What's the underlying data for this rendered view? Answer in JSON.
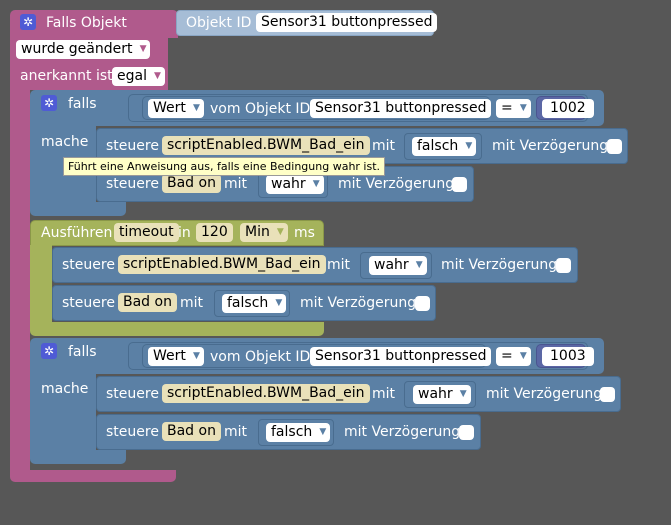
{
  "event_block": {
    "title": "Falls Objekt",
    "object_id_label": "Objekt ID",
    "object_id_value": "Sensor31 buttonpressed",
    "trigger_dropdown": "wurde geändert",
    "ack_label": "anerkannt ist",
    "ack_dropdown": "egal"
  },
  "if_blocks": [
    {
      "if_label": "falls",
      "do_label": "mache",
      "value_dropdown": "Wert",
      "of_object_label": "vom Objekt ID",
      "object_value": "Sensor31 buttonpressed",
      "operator": "=",
      "compare_value": "1002",
      "statements": [
        {
          "label": "steuere",
          "target": "scriptEnabled.BWM_Bad_ein",
          "with_label": "mit",
          "value": "falsch",
          "delay_label": "mit Verzögerung"
        },
        {
          "label": "steuere",
          "target": "Bad on",
          "with_label": "mit",
          "value": "wahr",
          "delay_label": "mit Verzögerung"
        }
      ]
    },
    {
      "if_label": "falls",
      "do_label": "mache",
      "value_dropdown": "Wert",
      "of_object_label": "vom Objekt ID",
      "object_value": "Sensor31 buttonpressed",
      "operator": "=",
      "compare_value": "1003",
      "statements": [
        {
          "label": "steuere",
          "target": "scriptEnabled.BWM_Bad_ein",
          "with_label": "mit",
          "value": "wahr",
          "delay_label": "mit Verzögerung"
        },
        {
          "label": "steuere",
          "target": "Bad on",
          "with_label": "mit",
          "value": "falsch",
          "delay_label": "mit Verzögerung"
        }
      ]
    }
  ],
  "timeout_block": {
    "label": "Ausführen",
    "name": "timeout",
    "in_label": "in",
    "value": "120",
    "unit": "Min",
    "suffix": "ms",
    "statements": [
      {
        "label": "steuere",
        "target": "scriptEnabled.BWM_Bad_ein",
        "with_label": "mit",
        "value": "wahr",
        "delay_label": "mit Verzögerung"
      },
      {
        "label": "steuere",
        "target": "Bad on",
        "with_label": "mit",
        "value": "falsch",
        "delay_label": "mit Verzögerung"
      }
    ]
  },
  "tooltip": "Führt eine Anweisung aus, falls eine Bedingung wahr ist.",
  "icons": {
    "gear": "gear-icon",
    "dropdown": "chevron-down-icon"
  },
  "colors": {
    "event": "#b05a8c",
    "logic": "#5b80a5",
    "timeout": "#a5b35b",
    "background": "#575757"
  }
}
